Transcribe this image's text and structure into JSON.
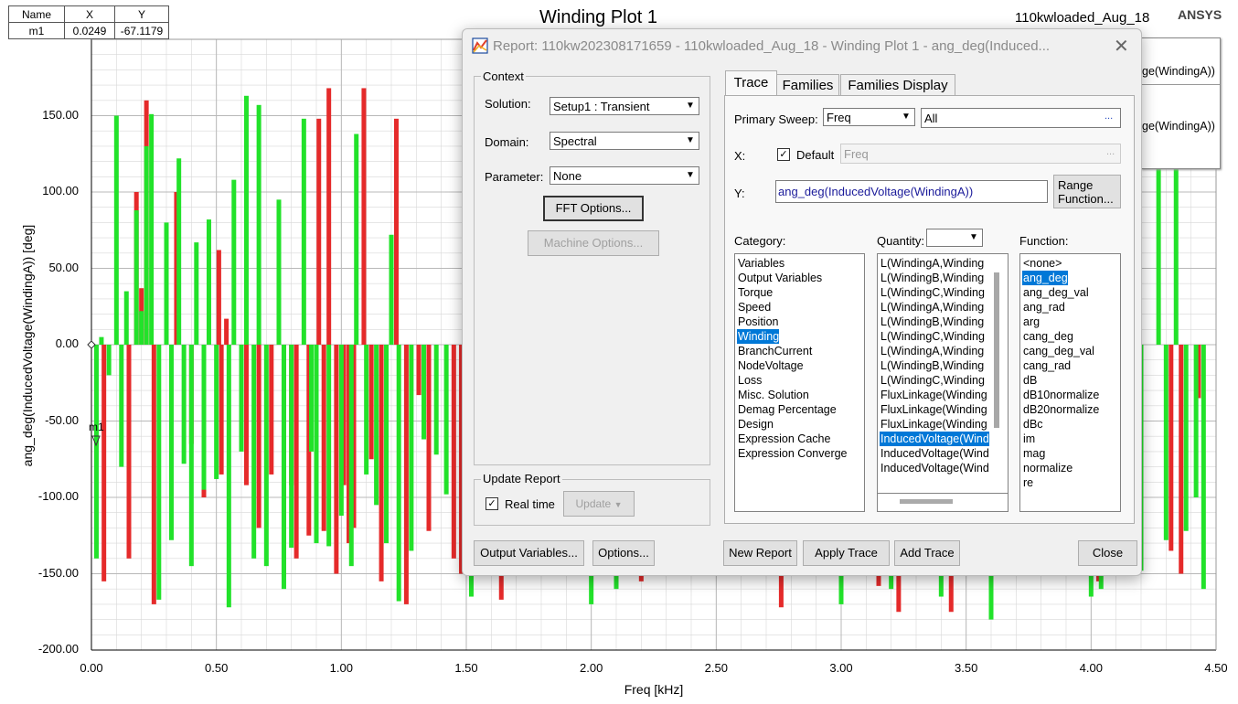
{
  "plot": {
    "title": "Winding Plot 1",
    "design_name": "110kwloaded_Aug_18",
    "brand": "ANSYS",
    "x_axis_label": "Freq [kHz]",
    "y_axis_label": "ang_deg(InducedVoltage(WindingA)) [deg]",
    "marker_label": "m1",
    "series_colors": {
      "trace_a": "#e52a2a",
      "trace_b": "#22e22a"
    },
    "grid_color": "#d8d8d8",
    "legend_fragment": [
      "ge(WindingA))",
      "ge(WindingA))"
    ]
  },
  "chart_data": {
    "type": "bar",
    "xlabel": "Freq [kHz]",
    "ylabel": "ang_deg(InducedVoltage(WindingA)) [deg]",
    "xlim": [
      0,
      4.5
    ],
    "ylim": [
      -200,
      200
    ],
    "x_ticks": [
      "0.00",
      "0.50",
      "1.00",
      "1.50",
      "2.00",
      "2.50",
      "3.00",
      "3.50",
      "4.00",
      "4.50"
    ],
    "y_ticks": [
      "150.00",
      "100.00",
      "50.00",
      "0.00",
      "-50.00",
      "-100.00",
      "-150.00",
      "-200.00"
    ],
    "grid": true,
    "series": [
      {
        "x": [
          0.05,
          0.15,
          0.18,
          0.2,
          0.22,
          0.25,
          0.34,
          0.4,
          0.45,
          0.51,
          0.52,
          0.54,
          0.6,
          0.62,
          0.67,
          0.72,
          0.77,
          0.8,
          0.82,
          0.87,
          0.91,
          0.93,
          0.95,
          0.98,
          1.01,
          1.03,
          1.05,
          1.09,
          1.12,
          1.16,
          1.22,
          1.26,
          1.31,
          1.35,
          1.45,
          1.48,
          1.64,
          2.2,
          2.76,
          3.15,
          3.23,
          3.44,
          3.65,
          3.76,
          4.03,
          4.32,
          4.36,
          4.43
        ],
        "values": [
          -155,
          -140,
          100,
          37,
          160,
          -170,
          100,
          -65,
          -100,
          62,
          -85,
          17,
          -50,
          -92,
          -120,
          -85,
          -152,
          -92,
          -140,
          -125,
          148,
          -122,
          168,
          -150,
          -92,
          -130,
          -120,
          168,
          -75,
          -155,
          148,
          -170,
          -33,
          -122,
          -140,
          -150,
          -167,
          -155,
          -172,
          -158,
          -175,
          -175,
          -130,
          -130,
          -155,
          -135,
          -150,
          -35
        ],
        "name": "",
        "color": "#e52a2a"
      },
      {
        "x": [
          0.02,
          0.04,
          0.07,
          0.1,
          0.12,
          0.14,
          0.18,
          0.2,
          0.22,
          0.24,
          0.27,
          0.3,
          0.32,
          0.35,
          0.37,
          0.4,
          0.42,
          0.45,
          0.47,
          0.5,
          0.55,
          0.57,
          0.6,
          0.62,
          0.65,
          0.67,
          0.7,
          0.75,
          0.77,
          0.8,
          0.85,
          0.88,
          0.9,
          0.95,
          1.0,
          1.04,
          1.06,
          1.1,
          1.14,
          1.18,
          1.2,
          1.23,
          1.28,
          1.33,
          1.38,
          1.42,
          1.52,
          1.78,
          1.9,
          2.0,
          2.1,
          2.24,
          2.8,
          3.0,
          3.2,
          3.4,
          3.6,
          3.8,
          4.0,
          4.04,
          4.1,
          4.15,
          4.2,
          4.27,
          4.3,
          4.34,
          4.38,
          4.42,
          4.45
        ],
        "values": [
          -140,
          5,
          -20,
          150,
          -80,
          35,
          88,
          22,
          130,
          151,
          -167,
          80,
          -128,
          122,
          -78,
          -145,
          67,
          -95,
          82,
          -88,
          -172,
          108,
          -70,
          163,
          -140,
          157,
          -145,
          95,
          -160,
          -133,
          148,
          -70,
          -130,
          -132,
          -112,
          -145,
          138,
          -85,
          -105,
          -130,
          72,
          -168,
          -135,
          -62,
          -72,
          -98,
          -165,
          -130,
          -145,
          -170,
          -160,
          -150,
          -150,
          -170,
          -160,
          -165,
          -180,
          -150,
          -165,
          -160,
          -140,
          -75,
          -148,
          150,
          -128,
          125,
          -122,
          -100,
          -160
        ],
        "name": "",
        "color": "#22e22a"
      }
    ]
  },
  "marker_table": {
    "headers": [
      "Name",
      "X",
      "Y"
    ],
    "row": [
      "m1",
      "0.0249",
      "-67.1179"
    ]
  },
  "dialog": {
    "title": "Report: 110kw202308171659 - 110kwloaded_Aug_18 - Winding Plot 1 - ang_deg(Induced...",
    "close_glyph": "✕",
    "context": {
      "group_label": "Context",
      "solution_label": "Solution:",
      "solution_value": "Setup1 : Transient",
      "domain_label": "Domain:",
      "domain_value": "Spectral",
      "parameter_label": "Parameter:",
      "parameter_value": "None",
      "fft_options": "FFT Options...",
      "machine_options": "Machine Options..."
    },
    "update": {
      "group_label": "Update Report",
      "realtime_label": "Real time",
      "update_button": "Update"
    },
    "tabs": [
      "Trace",
      "Families",
      "Families Display"
    ],
    "trace": {
      "primary_sweep_label": "Primary Sweep:",
      "primary_sweep_value": "Freq",
      "primary_sweep_range": "All",
      "x_label": "X:",
      "default_label": "Default",
      "x_value": "Freq",
      "y_label": "Y:",
      "y_value": "ang_deg(InducedVoltage(WindingA))",
      "range_function": "Range Function...",
      "ellipsis": "..."
    },
    "category_label": "Category:",
    "quantity_label": "Quantity:",
    "function_label": "Function:",
    "categories": [
      "Variables",
      "Output Variables",
      "Torque",
      "Speed",
      "Position",
      "Winding",
      "BranchCurrent",
      "NodeVoltage",
      "Loss",
      "Misc. Solution",
      "Demag Percentage",
      "Design",
      "Expression Cache",
      "Expression Converge"
    ],
    "categories_selected": 5,
    "quantities": [
      "L(WindingA,Winding",
      "L(WindingB,Winding",
      "L(WindingC,Winding",
      "L(WindingA,Winding",
      "L(WindingB,Winding",
      "L(WindingC,Winding",
      "L(WindingA,Winding",
      "L(WindingB,Winding",
      "L(WindingC,Winding",
      "FluxLinkage(Winding",
      "FluxLinkage(Winding",
      "FluxLinkage(Winding",
      "InducedVoltage(Wind",
      "InducedVoltage(Wind",
      "InducedVoltage(Wind"
    ],
    "quantities_selected": 12,
    "functions": [
      "<none>",
      "ang_deg",
      "ang_deg_val",
      "ang_rad",
      "arg",
      "cang_deg",
      "cang_deg_val",
      "cang_rad",
      "dB",
      "dB10normalize",
      "dB20normalize",
      "dBc",
      "im",
      "mag",
      "normalize",
      "re"
    ],
    "functions_selected": 1,
    "buttons": {
      "output_variables": "Output Variables...",
      "options": "Options...",
      "new_report": "New Report",
      "apply_trace": "Apply Trace",
      "add_trace": "Add Trace",
      "close": "Close"
    }
  }
}
